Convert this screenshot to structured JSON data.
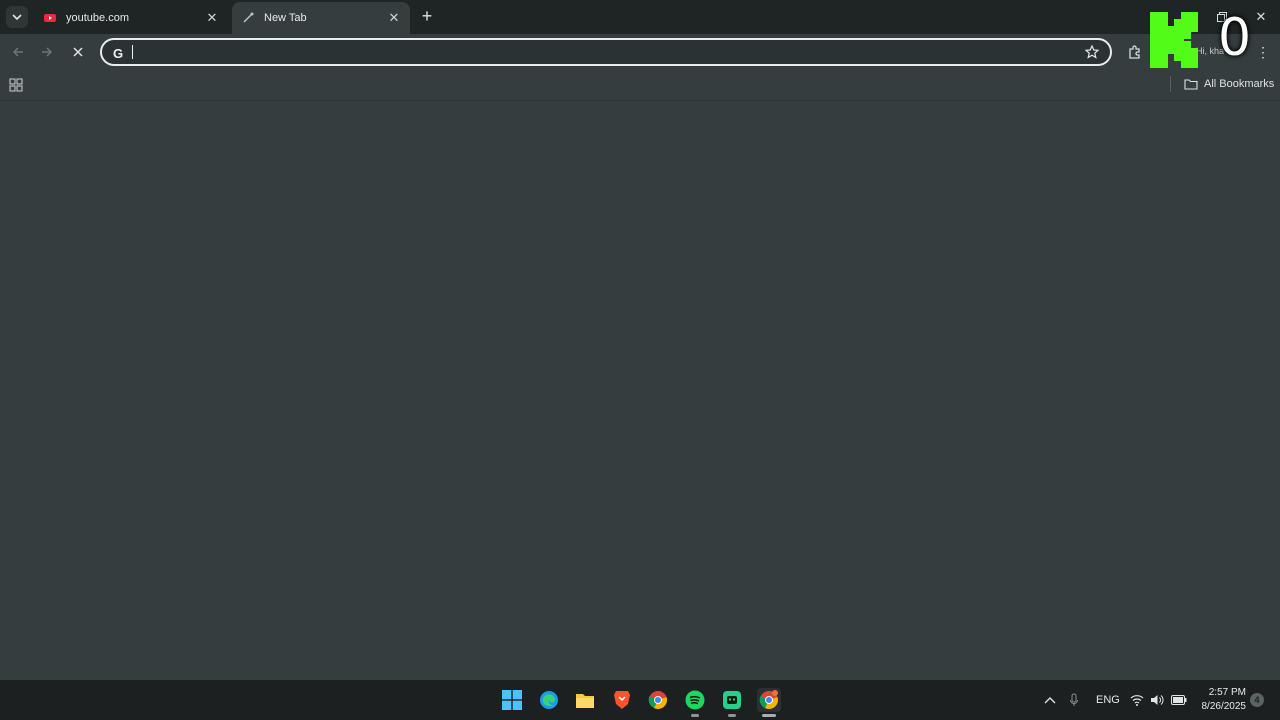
{
  "tabs": [
    {
      "title": "youtube.com",
      "favicon": "youtube-icon"
    },
    {
      "title": "New Tab",
      "favicon": "new-tab-icon"
    }
  ],
  "omnibox": {
    "value": "",
    "placeholder": ""
  },
  "bookmarks": {
    "all_label": "All Bookmarks"
  },
  "profile": {
    "greeting": "Hi, kha"
  },
  "overlay": {
    "counter": "0",
    "logo": "kick-logo"
  },
  "taskbar": {
    "apps": [
      "windows-start-icon",
      "edge-icon",
      "file-explorer-icon",
      "brave-icon",
      "chrome-icon",
      "spotify-icon",
      "app-icon",
      "chrome-canary-icon"
    ],
    "language": "ENG",
    "time": "2:57 PM",
    "date": "8/26/2025",
    "notifications": "4"
  },
  "colors": {
    "accent": "#53fc18",
    "background": "#353d3e",
    "tabstrip": "#1f2425"
  }
}
